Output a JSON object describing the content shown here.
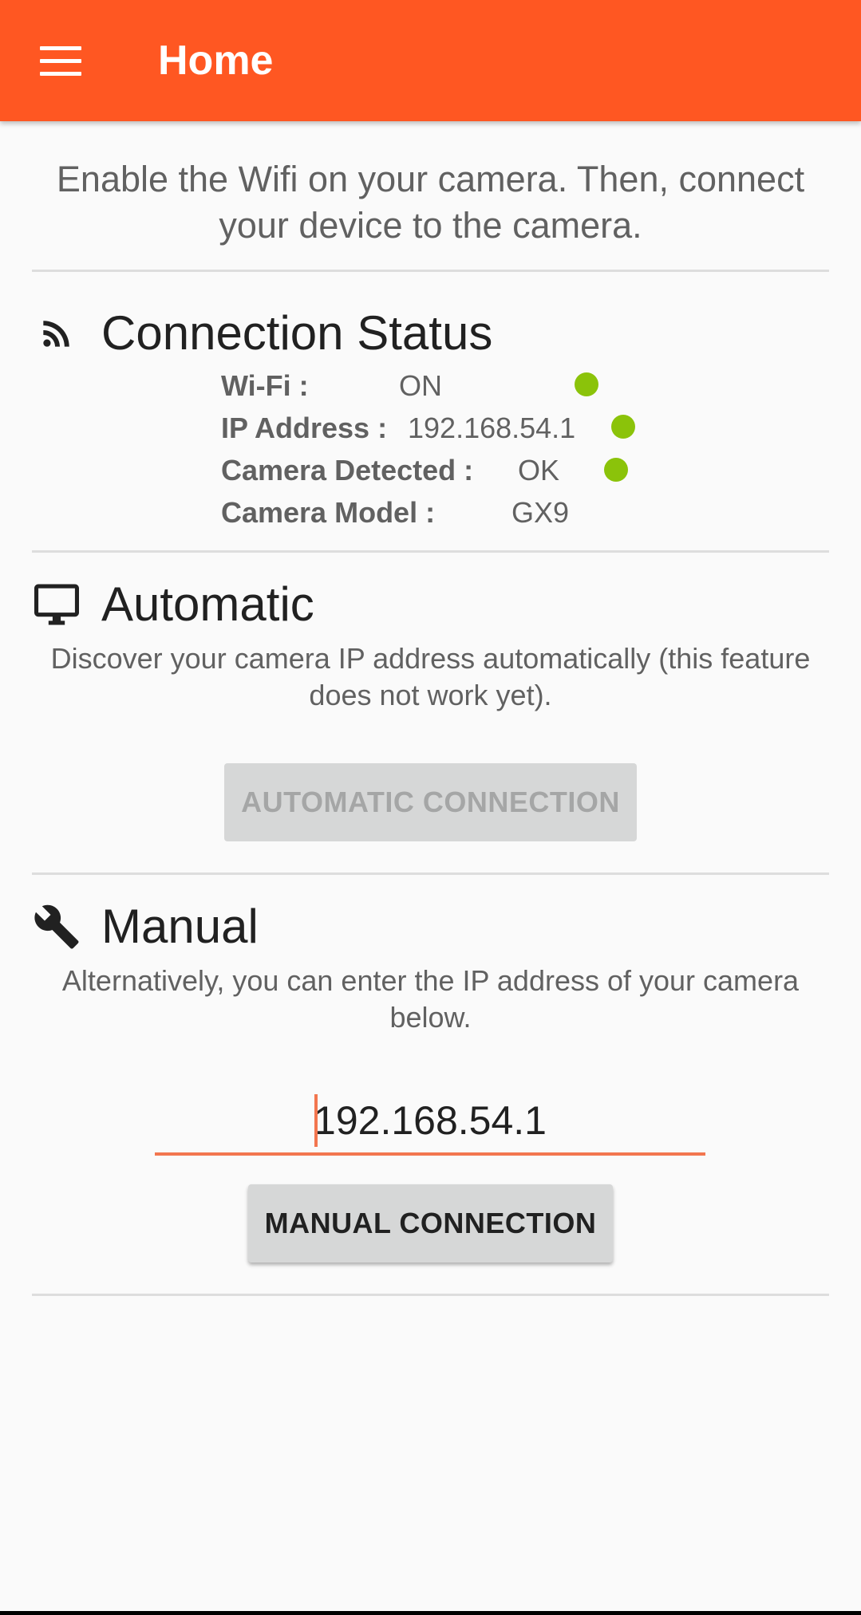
{
  "appbar": {
    "title": "Home",
    "menu_icon": "hamburger-menu-icon",
    "color": "#ff5722"
  },
  "intro_text": "Enable the Wifi on your camera. Then, connect your device to the camera.",
  "connection_status": {
    "title": "Connection Status",
    "icon": "rss-feed-icon",
    "rows": [
      {
        "label": "Wi-Fi :",
        "value": "ON",
        "indicator": "green"
      },
      {
        "label": "IP Address :",
        "value": "192.168.54.1",
        "indicator": "green"
      },
      {
        "label": "Camera Detected :",
        "value": "OK",
        "indicator": "green"
      },
      {
        "label": "Camera Model :",
        "value": "GX9",
        "indicator": null
      }
    ],
    "indicator_color": "#8bc30a"
  },
  "automatic": {
    "title": "Automatic",
    "icon": "monitor-icon",
    "description": "Discover your camera IP address automatically (this feature does not work yet).",
    "button_label": "AUTOMATIC CONNECTION",
    "button_enabled": false
  },
  "manual": {
    "title": "Manual",
    "icon": "wrench-icon",
    "description": "Alternatively, you can enter the IP address of your camera below.",
    "ip_value": "192.168.54.1",
    "button_label": "MANUAL CONNECTION",
    "accent_color": "#f2764f"
  }
}
